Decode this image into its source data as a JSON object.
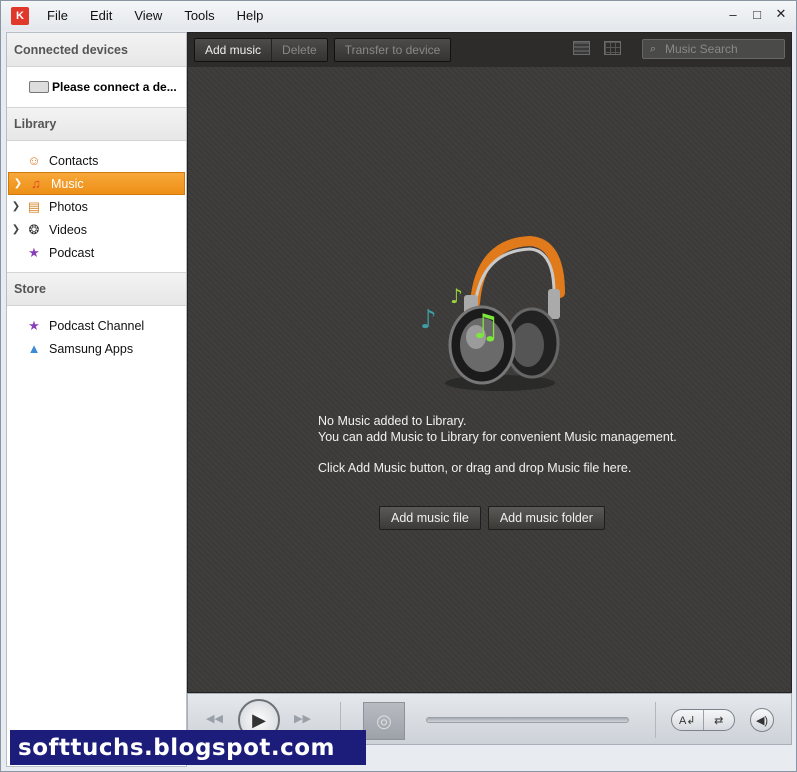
{
  "menu": {
    "app_logo_text": "K",
    "items": [
      "File",
      "Edit",
      "View",
      "Tools",
      "Help"
    ]
  },
  "window_controls": {
    "minimize": "–",
    "maximize": "□",
    "close": "✕"
  },
  "sidebar": {
    "connected_devices": {
      "heading": "Connected devices",
      "device_label": "Please connect a de..."
    },
    "library": {
      "heading": "Library",
      "items": [
        {
          "label": "Contacts",
          "icon": "contacts-icon",
          "glyph": "☺",
          "expandable": false,
          "selected": false
        },
        {
          "label": "Music",
          "icon": "music-note-icon",
          "glyph": "♫",
          "expandable": true,
          "selected": true
        },
        {
          "label": "Photos",
          "icon": "photos-icon",
          "glyph": "▤",
          "expandable": true,
          "selected": false
        },
        {
          "label": "Videos",
          "icon": "film-reel-icon",
          "glyph": "❂",
          "expandable": true,
          "selected": false
        },
        {
          "label": "Podcast",
          "icon": "podcast-icon",
          "glyph": "★",
          "expandable": false,
          "selected": false
        }
      ]
    },
    "store": {
      "heading": "Store",
      "items": [
        {
          "label": "Podcast Channel",
          "icon": "podcast-channel-icon",
          "glyph": "★"
        },
        {
          "label": "Samsung Apps",
          "icon": "samsung-apps-icon",
          "glyph": "▲"
        }
      ]
    }
  },
  "toolbar": {
    "add_music": "Add music",
    "delete": "Delete",
    "transfer": "Transfer to device",
    "search_placeholder": "Music Search"
  },
  "empty_state": {
    "line1": "No Music added to Library.",
    "line2": "You can add Music to Library for convenient Music management.",
    "line3": "Click Add Music button, or drag and drop Music file here.",
    "add_file": "Add music file",
    "add_folder": "Add music folder"
  },
  "player": {
    "prev_glyph": "◀◀",
    "play_glyph": "▶",
    "next_glyph": "▶▶",
    "album_glyph": "◎",
    "repeat_glyph": "A↲",
    "shuffle_glyph": "⇄",
    "volume_glyph": "◀)",
    "progress": 0
  },
  "watermark": "softtuchs.blogspot.com"
}
